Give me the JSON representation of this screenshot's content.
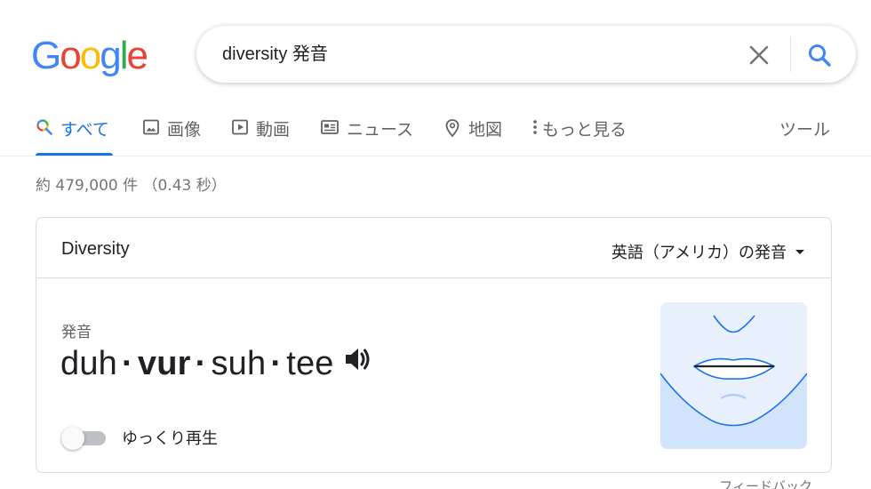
{
  "logo": {
    "letters": [
      "G",
      "o",
      "o",
      "g",
      "l",
      "e"
    ],
    "colors": [
      "#4285F4",
      "#EA4335",
      "#FBBC05",
      "#4285F4",
      "#34A853",
      "#EA4335"
    ]
  },
  "search": {
    "query": "diversity 発音"
  },
  "tabs": [
    {
      "label": "すべて",
      "icon": "search-icon",
      "active": true
    },
    {
      "label": "画像",
      "icon": "image-icon",
      "active": false
    },
    {
      "label": "動画",
      "icon": "video-icon",
      "active": false
    },
    {
      "label": "ニュース",
      "icon": "news-icon",
      "active": false
    },
    {
      "label": "地図",
      "icon": "map-pin-icon",
      "active": false
    },
    {
      "label": "もっと見る",
      "icon": "more-vert-icon",
      "active": false
    }
  ],
  "tools_label": "ツール",
  "result_stats": "約 479,000 件 （0.43 秒）",
  "card": {
    "title": "Diversity",
    "language_select": "英語（アメリカ）の発音",
    "pronunciation_label": "発音",
    "syllables": [
      {
        "text": "duh",
        "stressed": false
      },
      {
        "text": "vur",
        "stressed": true
      },
      {
        "text": "suh",
        "stressed": false
      },
      {
        "text": "tee",
        "stressed": false
      }
    ],
    "slow_playback_label": "ゆっくり再生",
    "slow_playback_on": false
  },
  "feedback": "フィードバック",
  "colors": {
    "accent": "#1a73e8",
    "text": "#202124",
    "secondary": "#5f6368"
  }
}
